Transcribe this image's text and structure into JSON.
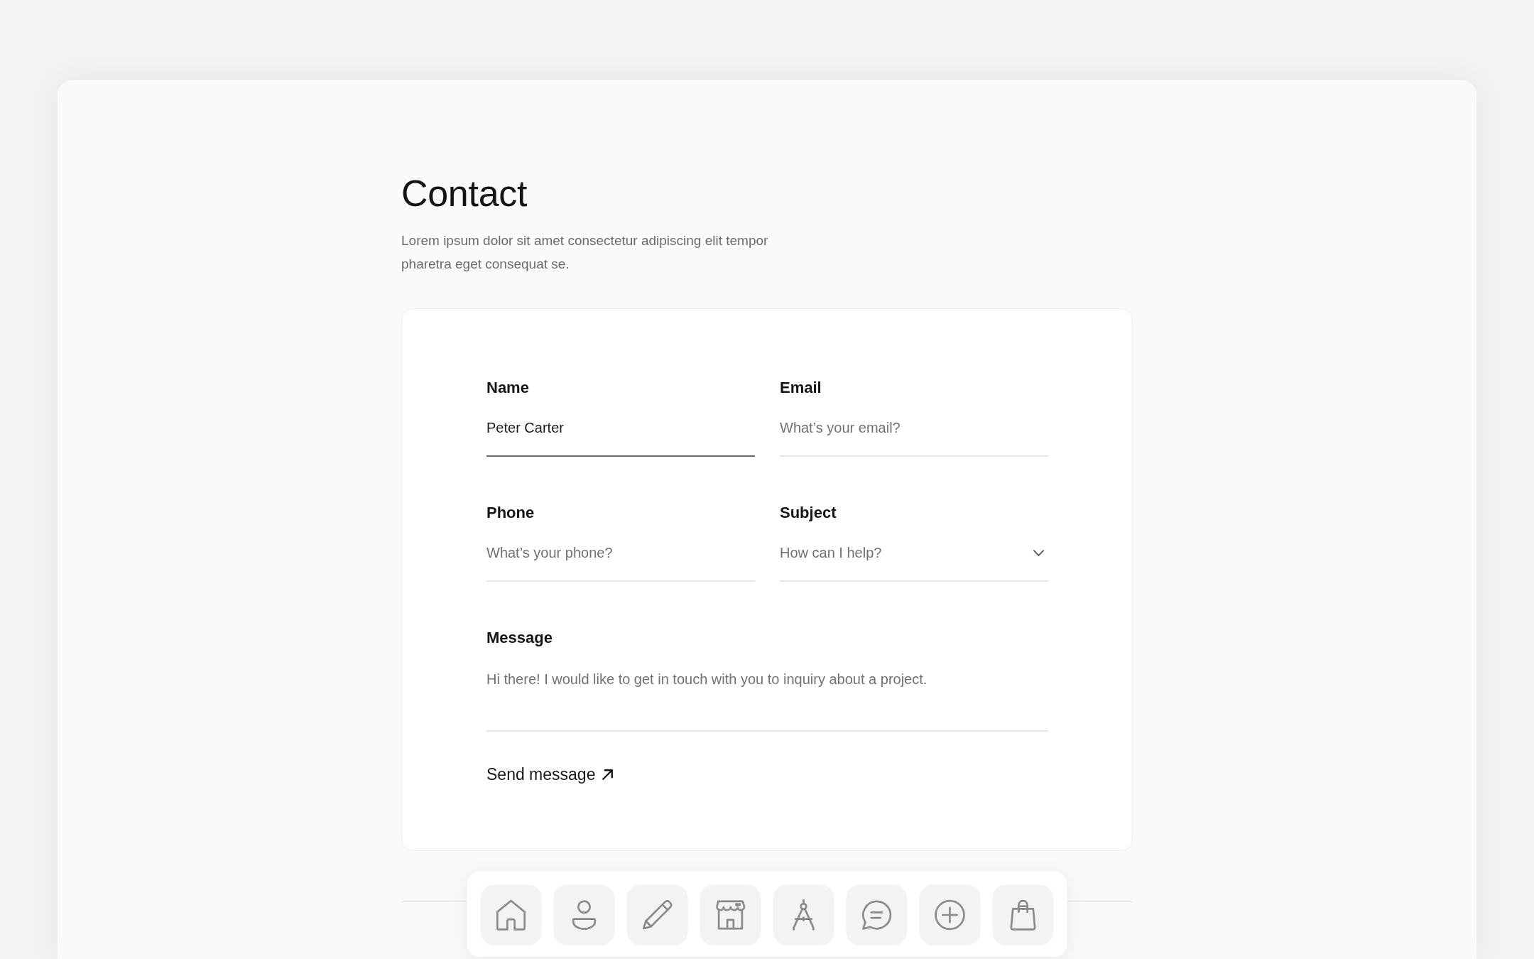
{
  "page": {
    "title": "Contact",
    "description": "Lorem ipsum dolor sit amet consectetur adipiscing elit tempor pharetra eget consequat se."
  },
  "form": {
    "fields": [
      {
        "kind": "text",
        "label": "Name",
        "value": "Peter Carter",
        "focused": true
      },
      {
        "kind": "text",
        "label": "Email",
        "placeholder": "What’s your email?",
        "focused": false
      },
      {
        "kind": "text",
        "label": "Phone",
        "placeholder": "What’s your phone?",
        "focused": false
      },
      {
        "kind": "select",
        "label": "Subject",
        "placeholder": "How can I help?",
        "focused": false
      },
      {
        "kind": "textarea",
        "label": "Message",
        "placeholder": "Hi there! I would like to get in touch with you to inquiry about a project.",
        "focused": false
      }
    ],
    "submit": {
      "label": "Send message"
    }
  }
}
